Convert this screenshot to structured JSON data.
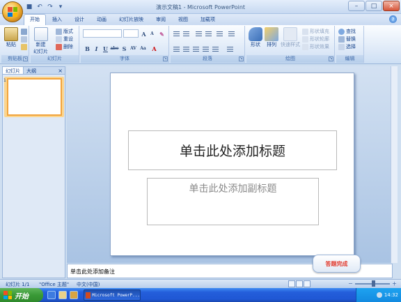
{
  "window": {
    "title": "演示文稿1 - Microsoft PowerPoint",
    "controls": {
      "minimize": "–",
      "maximize": "□",
      "close": "×"
    }
  },
  "quick_access": [
    "save-icon",
    "undo-icon",
    "redo-icon",
    "customize-icon"
  ],
  "tabs": [
    {
      "label": "开始",
      "active": true
    },
    {
      "label": "插入"
    },
    {
      "label": "设计"
    },
    {
      "label": "动画"
    },
    {
      "label": "幻灯片放映"
    },
    {
      "label": "审阅"
    },
    {
      "label": "视图"
    },
    {
      "label": "加载项"
    }
  ],
  "ribbon": {
    "clipboard": {
      "label": "剪贴板",
      "paste": "粘贴"
    },
    "slides": {
      "label": "幻灯片",
      "new_slide": "新建\n幻灯片",
      "layout": "版式",
      "reset": "重设",
      "delete": "删除"
    },
    "font": {
      "label": "字体",
      "font_name": "",
      "font_size": "",
      "grow": "A",
      "shrink": "A",
      "buttons": [
        "B",
        "I",
        "U",
        "abe",
        "S",
        "AV",
        "Aa",
        "A"
      ]
    },
    "paragraph": {
      "label": "段落"
    },
    "drawing": {
      "label": "绘图",
      "shapes": "形状",
      "arrange": "排列",
      "quick_styles": "快速样式",
      "fill": "形状填充",
      "outline": "形状轮廓",
      "effects": "形状效果"
    },
    "editing": {
      "label": "编辑",
      "find": "查找",
      "replace": "替换",
      "select": "选择"
    }
  },
  "panel": {
    "tabs": [
      {
        "label": "幻灯片",
        "active": true
      },
      {
        "label": "大纲"
      }
    ],
    "close": "×",
    "thumbnail_number": "1"
  },
  "slide": {
    "title_placeholder": "单击此处添加标题",
    "subtitle_placeholder": "单击此处添加副标题"
  },
  "notes_placeholder": "单击此处添加备注",
  "badge": "答题完成",
  "status": {
    "slide_count": "幻灯片 1/1",
    "theme": "\"Office 主题\"",
    "language": "中文(中国)",
    "zoom_minus": "－",
    "zoom_plus": "＋"
  },
  "taskbar": {
    "start_label": "开始",
    "task_button": "Microsoft PowerP...",
    "clock": "14:32"
  },
  "colors": {
    "accent": "#15428b",
    "selected_thumbnail": "#f1a33c",
    "badge_text": "#e23b2e"
  }
}
